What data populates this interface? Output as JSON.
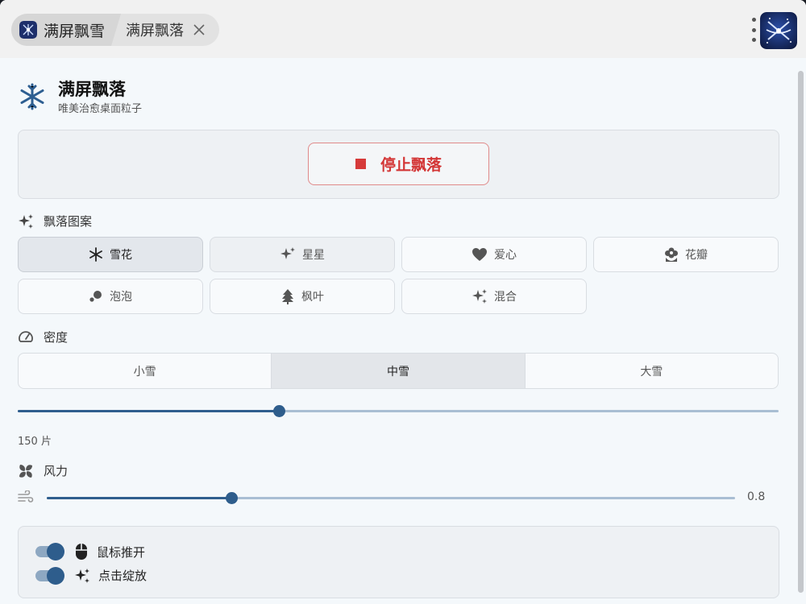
{
  "tabs": {
    "app_tab_label": "满屏飘雪",
    "page_tab_label": "满屏飘落"
  },
  "header": {
    "title": "满屏飘落",
    "subtitle": "唯美治愈桌面粒子"
  },
  "action": {
    "stop_label": "停止飘落"
  },
  "patterns": {
    "section_label": "飘落图案",
    "items": [
      {
        "label": "雪花",
        "icon": "snowflake-icon",
        "state": "selected"
      },
      {
        "label": "星星",
        "icon": "sparkle-icon",
        "state": "hover"
      },
      {
        "label": "爱心",
        "icon": "heart-icon",
        "state": "normal"
      },
      {
        "label": "花瓣",
        "icon": "flower-icon",
        "state": "normal"
      },
      {
        "label": "泡泡",
        "icon": "bubbles-icon",
        "state": "normal"
      },
      {
        "label": "枫叶",
        "icon": "tree-icon",
        "state": "normal"
      },
      {
        "label": "混合",
        "icon": "sparkle-icon",
        "state": "normal"
      }
    ]
  },
  "density": {
    "section_label": "密度",
    "options": [
      "小雪",
      "中雪",
      "大雪"
    ],
    "selected": "中雪",
    "slider_fraction": 0.343,
    "count_label": "150 片"
  },
  "wind": {
    "section_label": "风力",
    "slider_fraction": 0.268,
    "value": "0.8"
  },
  "toggles": [
    {
      "label": "鼠标推开",
      "icon": "mouse-icon",
      "on": true
    },
    {
      "label": "点击绽放",
      "icon": "sparkle-icon",
      "on": true
    }
  ],
  "colors": {
    "accent": "#2e5d8c",
    "danger": "#d33636",
    "panel_bg": "#f4f8fb"
  }
}
